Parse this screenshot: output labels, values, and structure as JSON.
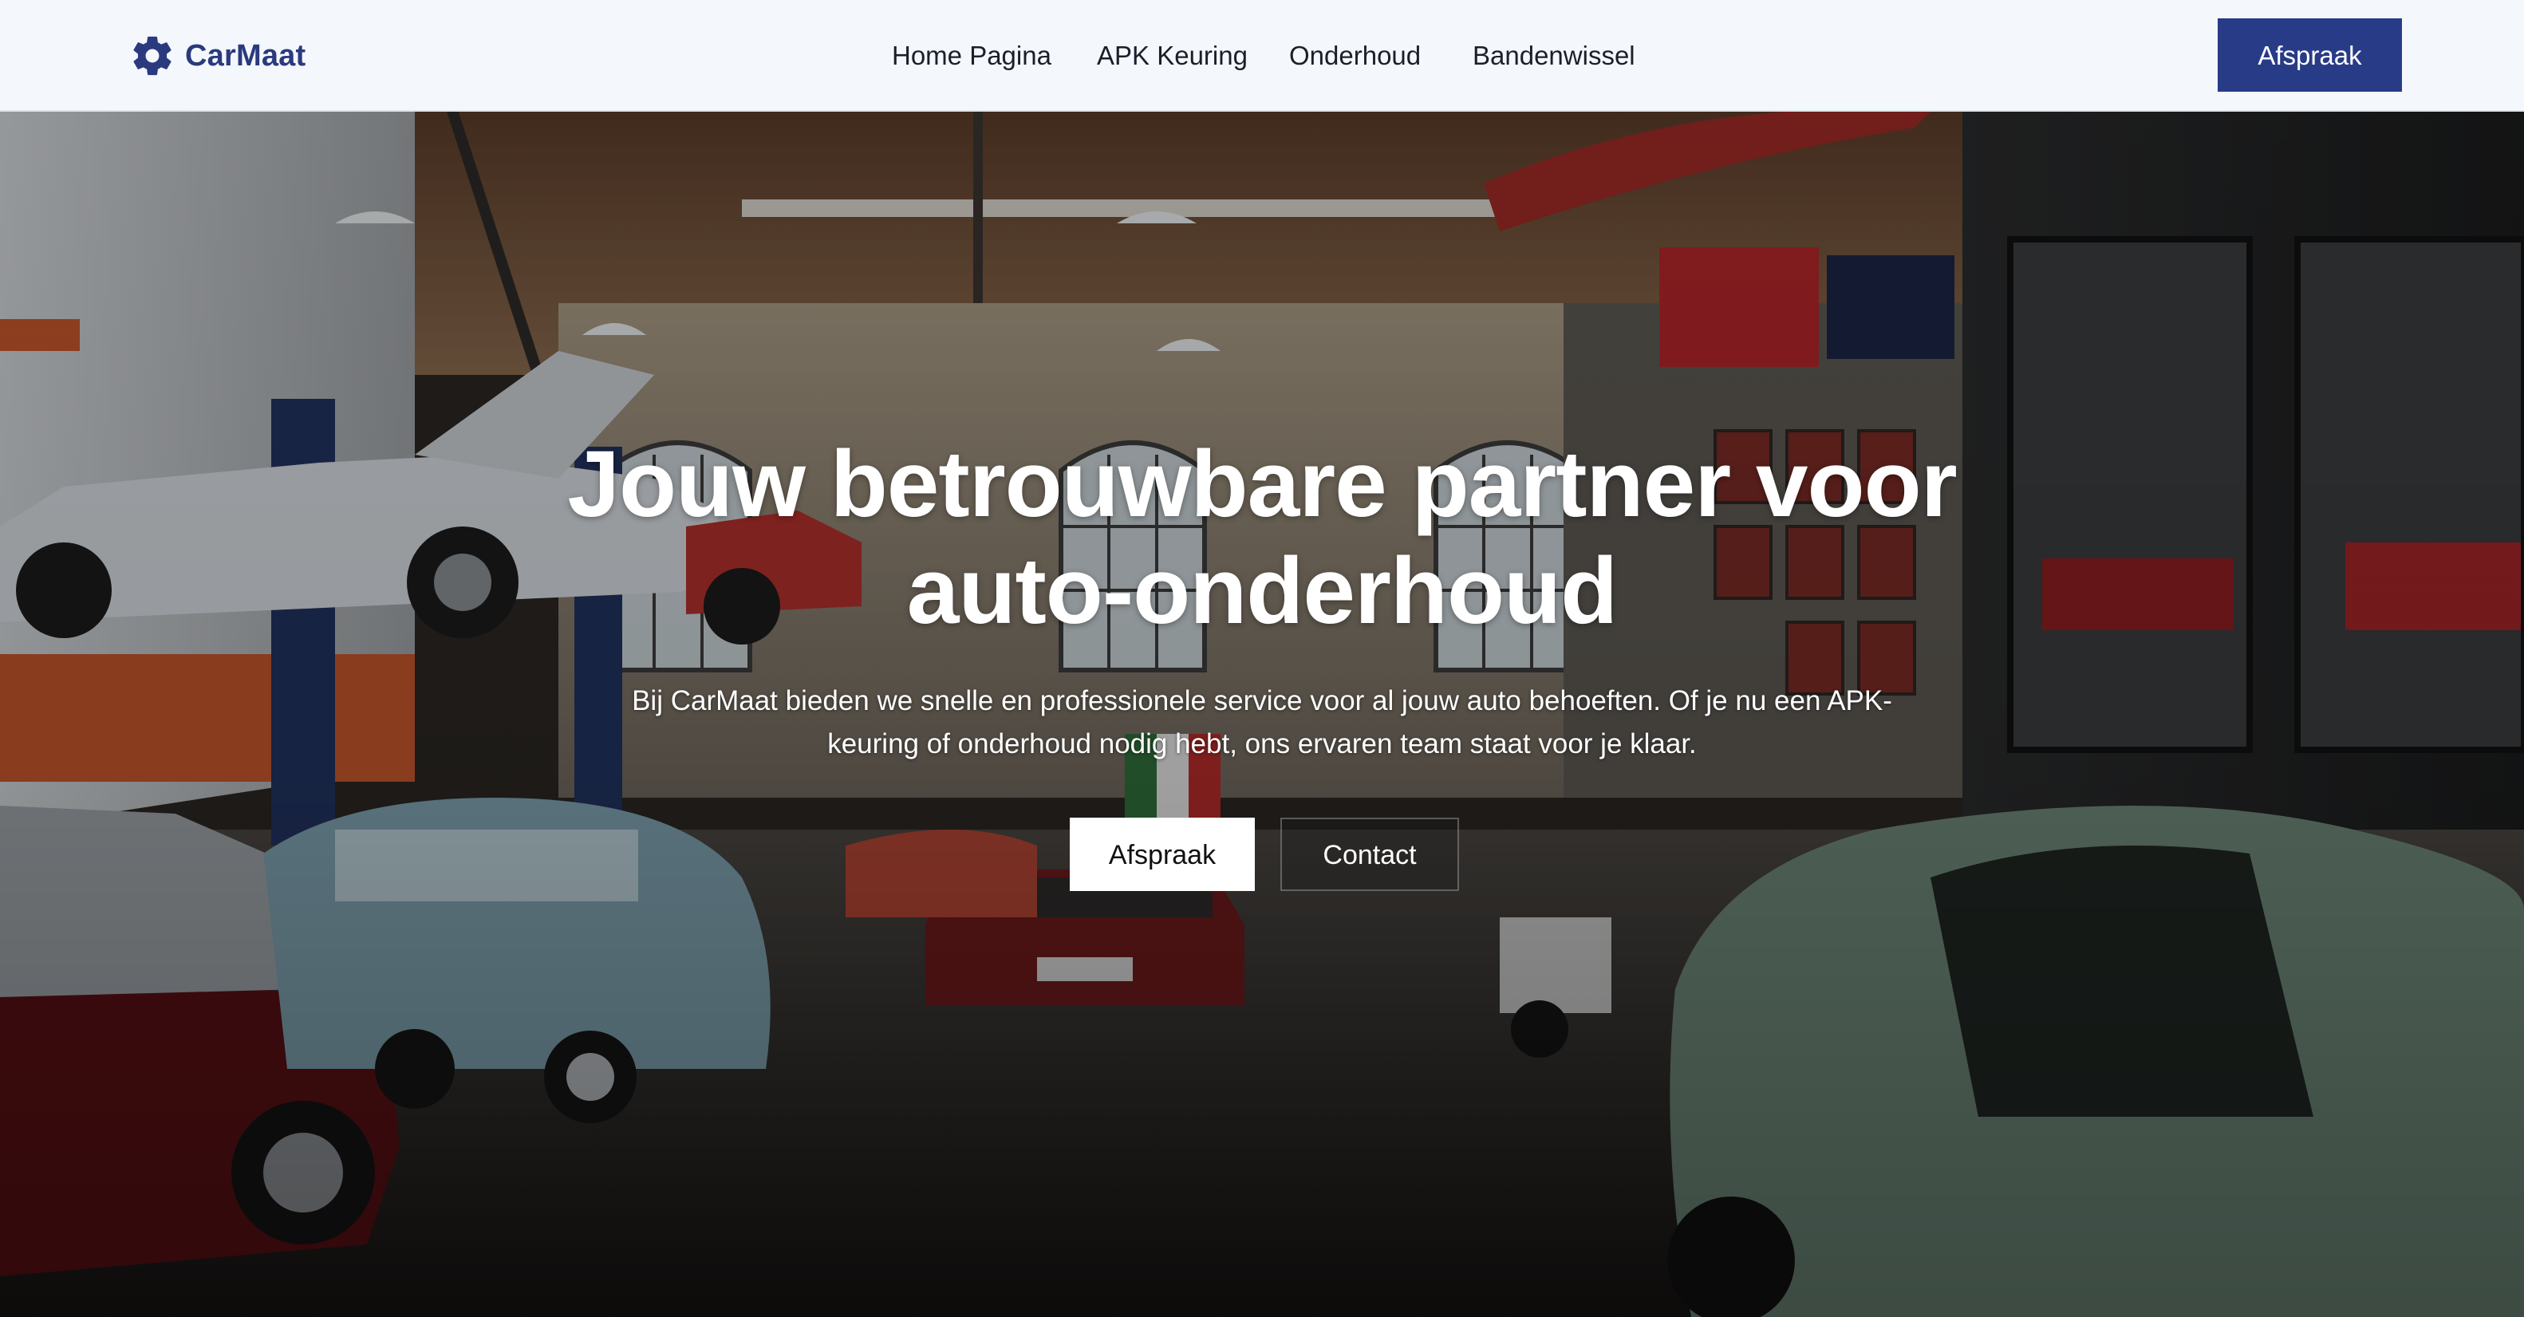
{
  "brand": {
    "name": "CarMaat",
    "icon": "gear-icon",
    "color": "#2b3a7e"
  },
  "nav": {
    "links": [
      {
        "label": "Home Pagina"
      },
      {
        "label": "APK Keuring"
      },
      {
        "label": "Onderhoud"
      },
      {
        "label": "Bandenwissel"
      }
    ],
    "cta_label": "Afspraak",
    "cta_color": "#283b86",
    "background": "#f4f8fc"
  },
  "hero": {
    "title": "Jouw betrouwbare partner voor auto-onderhoud",
    "subtitle": "Bij CarMaat bieden we snelle en professionele service voor al jouw auto behoeften. Of je nu een APK-keuring of onderhoud nodig hebt, ons ervaren team staat voor je klaar.",
    "primary_button": "Afspraak",
    "secondary_button": "Contact",
    "background_image": "garage-interior-with-classic-cars"
  }
}
